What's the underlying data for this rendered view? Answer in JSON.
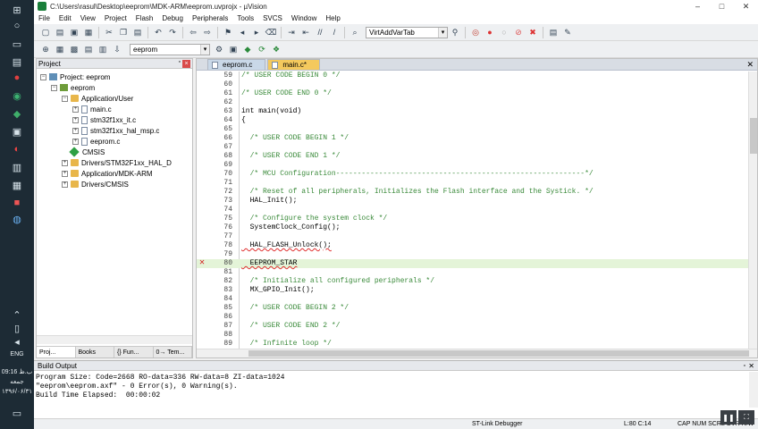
{
  "taskbar": {
    "time": "09:16 ب.ظ",
    "weekday": "جمعه",
    "date": "۱۳۹۶/۰۶/۳۱",
    "language": "ENG"
  },
  "window": {
    "title": "C:\\Users\\rasul\\Desktop\\eeprom\\MDK-ARM\\eeprom.uvprojx - µVision",
    "minimize": "–",
    "maximize": "□",
    "close": "✕"
  },
  "menu": [
    "File",
    "Edit",
    "View",
    "Project",
    "Flash",
    "Debug",
    "Peripherals",
    "Tools",
    "SVCS",
    "Window",
    "Help"
  ],
  "toolbar": {
    "find_combo": "VirtAddVarTab",
    "target_combo": "eeprom"
  },
  "project_panel": {
    "title": "Project",
    "root": "Project: eeprom",
    "target": "eeprom",
    "groups": [
      {
        "name": "Application/User",
        "files": [
          "main.c",
          "stm32f1xx_it.c",
          "stm32f1xx_hal_msp.c",
          "eeprom.c"
        ]
      },
      {
        "name": "CMSIS",
        "files": []
      },
      {
        "name": "Drivers/STM32F1xx_HAL_D",
        "files": []
      },
      {
        "name": "Application/MDK-ARM",
        "files": []
      },
      {
        "name": "Drivers/CMSIS",
        "files": []
      }
    ],
    "tabs": [
      "Proj...",
      "Books",
      "{} Fun...",
      "0→ Tem..."
    ]
  },
  "editor": {
    "tabs": [
      "eeprom.c",
      "main.c*"
    ],
    "active_tab": "main.c*",
    "lines": [
      {
        "n": "59",
        "text": "/* USER CODE BEGIN 0 */",
        "type": "cm"
      },
      {
        "n": "60",
        "text": "",
        "type": "kw"
      },
      {
        "n": "61",
        "text": "/* USER CODE END 0 */",
        "type": "cm"
      },
      {
        "n": "62",
        "text": "",
        "type": "kw"
      },
      {
        "n": "63",
        "text": "int main(void)",
        "type": "kw"
      },
      {
        "n": "64",
        "text": "{",
        "type": "kw"
      },
      {
        "n": "65",
        "text": "",
        "type": "kw"
      },
      {
        "n": "66",
        "text": "  /* USER CODE BEGIN 1 */",
        "type": "cm"
      },
      {
        "n": "67",
        "text": "",
        "type": "kw"
      },
      {
        "n": "68",
        "text": "  /* USER CODE END 1 */",
        "type": "cm"
      },
      {
        "n": "69",
        "text": "",
        "type": "kw"
      },
      {
        "n": "70",
        "text": "  /* MCU Configuration----------------------------------------------------------*/",
        "type": "cm"
      },
      {
        "n": "71",
        "text": "",
        "type": "kw"
      },
      {
        "n": "72",
        "text": "  /* Reset of all peripherals, Initializes the Flash interface and the Systick. */",
        "type": "cm"
      },
      {
        "n": "73",
        "text": "  HAL_Init();",
        "type": "kw"
      },
      {
        "n": "74",
        "text": "",
        "type": "kw"
      },
      {
        "n": "75",
        "text": "  /* Configure the system clock */",
        "type": "cm"
      },
      {
        "n": "76",
        "text": "  SystemClock_Config();",
        "type": "kw"
      },
      {
        "n": "77",
        "text": "",
        "type": "kw"
      },
      {
        "n": "78",
        "text": "  HAL_FLASH_Unlock();",
        "type": "kw",
        "squiggle": true
      },
      {
        "n": "79",
        "text": "",
        "type": "kw"
      },
      {
        "n": "80",
        "text": "  EEPROM_STAR",
        "type": "kw",
        "squiggle": true,
        "error": true,
        "current": true
      },
      {
        "n": "81",
        "text": "",
        "type": "kw"
      },
      {
        "n": "82",
        "text": "  /* Initialize all configured peripherals */",
        "type": "cm"
      },
      {
        "n": "83",
        "text": "  MX_GPIO_Init();",
        "type": "kw"
      },
      {
        "n": "84",
        "text": "",
        "type": "kw"
      },
      {
        "n": "85",
        "text": "  /* USER CODE BEGIN 2 */",
        "type": "cm"
      },
      {
        "n": "86",
        "text": "",
        "type": "kw"
      },
      {
        "n": "87",
        "text": "  /* USER CODE END 2 */",
        "type": "cm"
      },
      {
        "n": "88",
        "text": "",
        "type": "kw"
      },
      {
        "n": "89",
        "text": "  /* Infinite loop */",
        "type": "cm"
      }
    ]
  },
  "build_output": {
    "title": "Build Output",
    "lines": [
      "Program Size: Code=2668 RO-data=336 RW-data=8 ZI-data=1024",
      "\"eeprom\\eeprom.axf\" - 0 Error(s), 0 Warning(s).",
      "Build Time Elapsed:  00:00:02"
    ]
  },
  "statusbar": {
    "debugger": "ST-Link Debugger",
    "position": "L:80 C:14",
    "modes": "CAP NUM SCRL OVR R/W"
  }
}
